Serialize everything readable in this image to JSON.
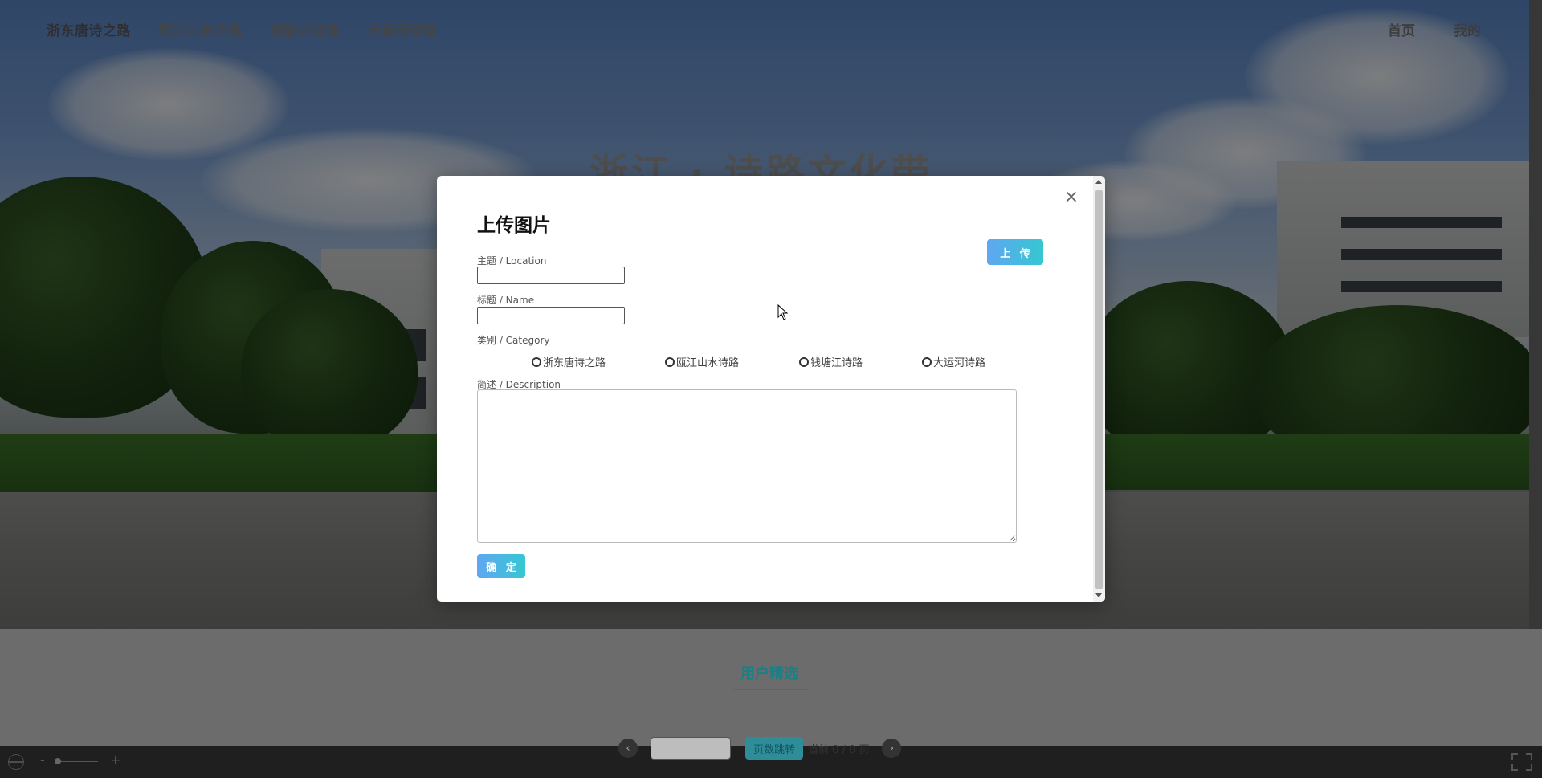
{
  "nav": {
    "items": [
      {
        "label": "浙东唐诗之路"
      },
      {
        "label": "瓯江山水诗路"
      },
      {
        "label": "钱塘江诗路"
      },
      {
        "label": "大运河诗路"
      }
    ],
    "right": [
      {
        "label": "首页"
      },
      {
        "label": "我的"
      }
    ]
  },
  "hero": {
    "title": "浙江 · 诗路文化带"
  },
  "modal": {
    "title": "上传图片",
    "upload_label": "上 传",
    "close_symbol": "×",
    "location_label": "主题 / Location",
    "location_value": "",
    "name_label": "标题 / Name",
    "name_value": "",
    "category_label": "类别 / Category",
    "categories": [
      "浙东唐诗之路",
      "瓯江山水诗路",
      "钱塘江诗路",
      "大运河诗路"
    ],
    "description_label": "简述 / Description",
    "description_value": "",
    "confirm_label": "确 定"
  },
  "section": {
    "title": "用户精选"
  },
  "pager": {
    "prev_icon": "chevron-left-icon",
    "next_icon": "chevron-right-icon",
    "jump_label": "页数跳转",
    "page_text": "当前 0 / 0 页"
  },
  "viewer": {
    "zoom_minus": "-",
    "zoom_plus": "+",
    "icons": [
      "globe-icon",
      "fullscreen-icon"
    ]
  },
  "colors": {
    "accent_teal": "#1b7f86",
    "button_gradient_start": "#5fa7f2",
    "button_gradient_end": "#35c7d2"
  }
}
